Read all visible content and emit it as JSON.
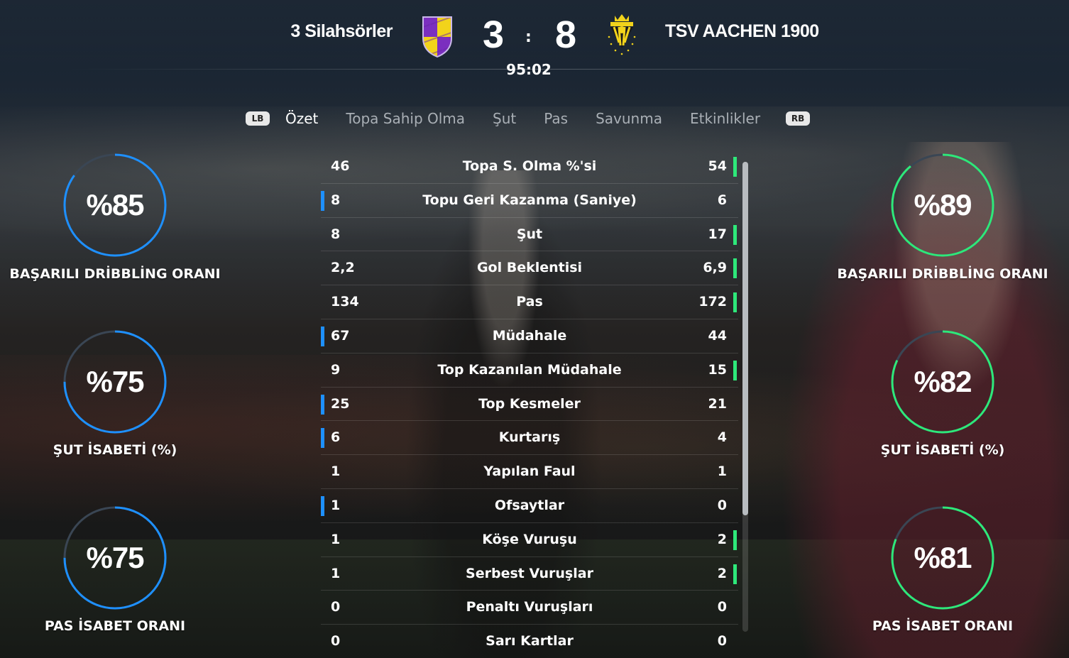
{
  "header": {
    "home_team": "3 Silahsörler",
    "away_team": "TSV AACHEN 1900",
    "home_score": "3",
    "away_score": "8",
    "separator": ":",
    "clock": "95:02"
  },
  "tabs": {
    "left_hint": "LB",
    "right_hint": "RB",
    "items": [
      "Özet",
      "Topa Sahip Olma",
      "Şut",
      "Pas",
      "Savunma",
      "Etkinlikler"
    ],
    "active": "Özet"
  },
  "home_rings": [
    {
      "value": "%85",
      "label": "BAŞARILI DRİBBLİNG ORANI",
      "fraction": 0.85
    },
    {
      "value": "%75",
      "label": "ŞUT İSABETİ (%)",
      "fraction": 0.75
    },
    {
      "value": "%75",
      "label": "PAS İSABET ORANI",
      "fraction": 0.75
    }
  ],
  "away_rings": [
    {
      "value": "%89",
      "label": "BAŞARILI DRİBBLİNG ORANI",
      "fraction": 0.89
    },
    {
      "value": "%82",
      "label": "ŞUT İSABETİ (%)",
      "fraction": 0.82
    },
    {
      "value": "%81",
      "label": "PAS İSABET ORANI",
      "fraction": 0.81
    }
  ],
  "stats": [
    {
      "name": "Topa S. Olma %'si",
      "home": "46",
      "away": "54",
      "leader": "away"
    },
    {
      "name": "Topu Geri Kazanma (Saniye)",
      "home": "8",
      "away": "6",
      "leader": "home"
    },
    {
      "name": "Şut",
      "home": "8",
      "away": "17",
      "leader": "away"
    },
    {
      "name": "Gol Beklentisi",
      "home": "2,2",
      "away": "6,9",
      "leader": "away"
    },
    {
      "name": "Pas",
      "home": "134",
      "away": "172",
      "leader": "away"
    },
    {
      "name": "Müdahale",
      "home": "67",
      "away": "44",
      "leader": "home"
    },
    {
      "name": "Top Kazanılan Müdahale",
      "home": "9",
      "away": "15",
      "leader": "away"
    },
    {
      "name": "Top Kesmeler",
      "home": "25",
      "away": "21",
      "leader": "home"
    },
    {
      "name": "Kurtarış",
      "home": "6",
      "away": "4",
      "leader": "home"
    },
    {
      "name": "Yapılan Faul",
      "home": "1",
      "away": "1",
      "leader": "none"
    },
    {
      "name": "Ofsaytlar",
      "home": "1",
      "away": "0",
      "leader": "home"
    },
    {
      "name": "Köşe Vuruşu",
      "home": "1",
      "away": "2",
      "leader": "away"
    },
    {
      "name": "Serbest Vuruşlar",
      "home": "1",
      "away": "2",
      "leader": "away"
    },
    {
      "name": "Penaltı Vuruşları",
      "home": "0",
      "away": "0",
      "leader": "none"
    },
    {
      "name": "Sarı Kartlar",
      "home": "0",
      "away": "0",
      "leader": "none"
    }
  ],
  "colors": {
    "home_accent": "#1e90ff",
    "away_accent": "#2ee87a",
    "ring_track": "#3a4654",
    "home_crest_purple": "#7b2fbf",
    "home_crest_yellow": "#f2d31b",
    "away_crest_yellow": "#f2d31b"
  },
  "icons": {
    "home_crest": "purple-yellow-quartered-shield-crest",
    "away_crest": "yellow-black-striped-crown-crest",
    "left_bumper": "lb-button-icon",
    "right_bumper": "rb-button-icon"
  }
}
